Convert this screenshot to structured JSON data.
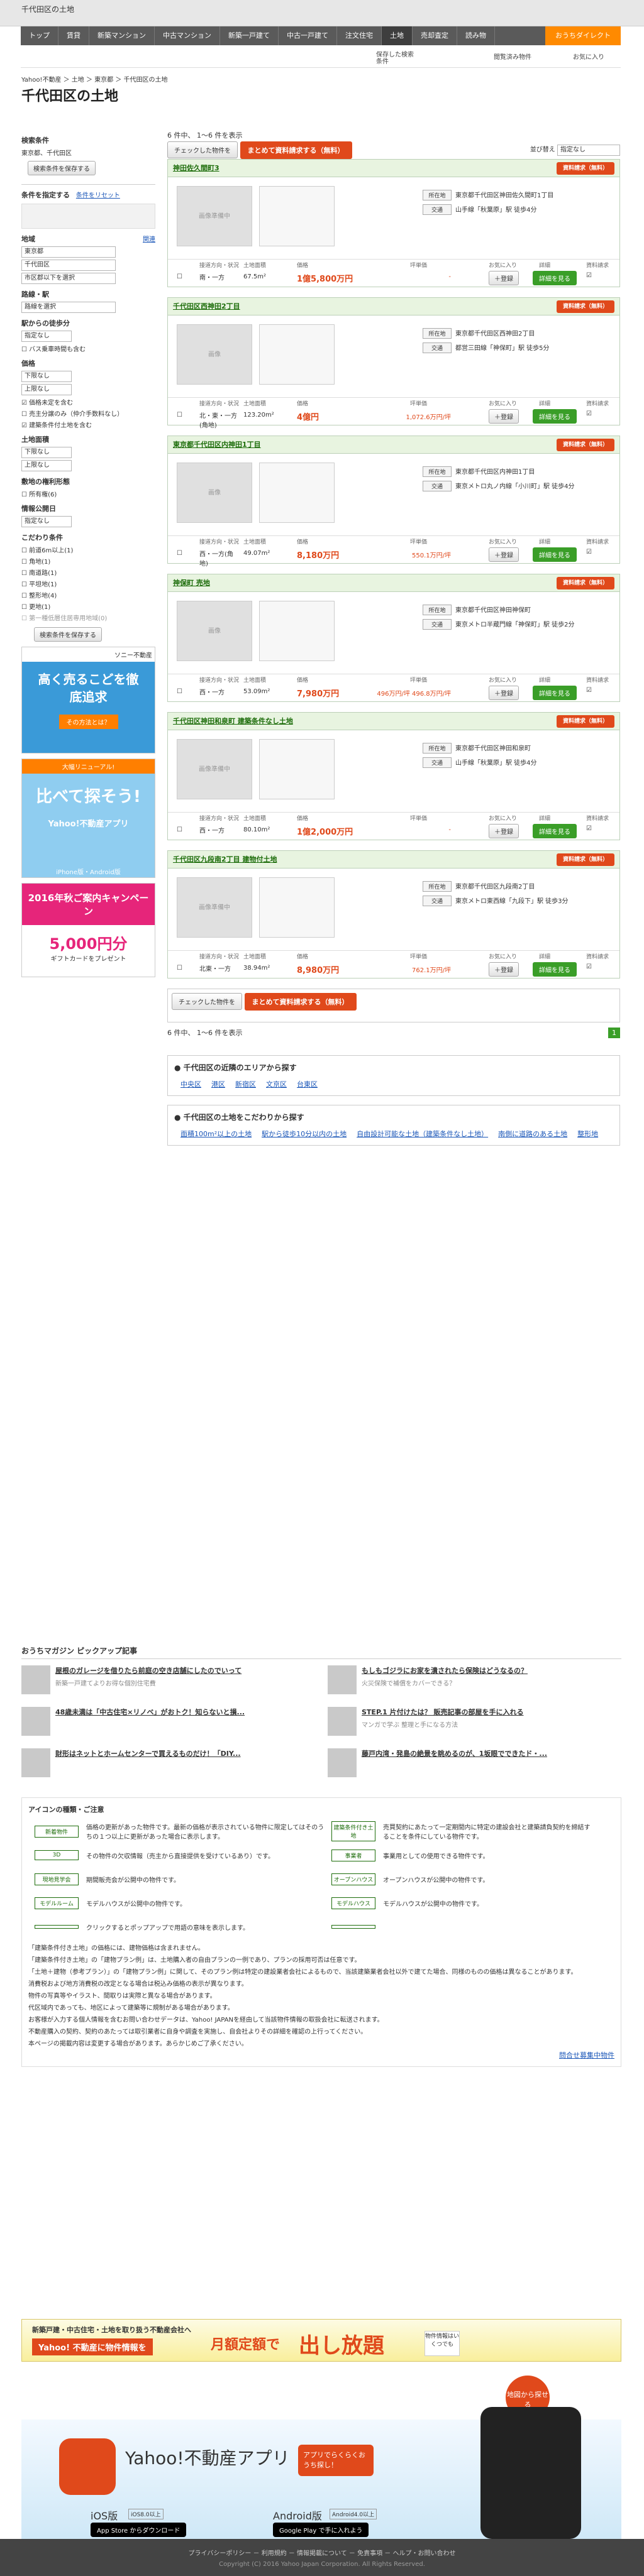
{
  "header": {
    "site": "Yahoo!不動産",
    "breadcrumb_top": "千代田区の土地"
  },
  "nav": {
    "items": [
      "トップ",
      "賃貸",
      "新築マンション",
      "中古マンション",
      "新築一戸建て",
      "中古一戸建て",
      "注文住宅",
      "土地",
      "売却査定",
      "読み物"
    ],
    "direct": "おうちダイレクト"
  },
  "subhead": {
    "saved": "保存した検索条件",
    "fav": "閲覧済み物件",
    "bookmark": "お気に入り"
  },
  "breadcrumb": "Yahoo!不動産 ＞ 土地 ＞ 東京都 ＞ 千代田区の土地",
  "title": "千代田区の土地",
  "sidebar": {
    "cond_title": "検索条件",
    "cond_value": "東京都、千代田区",
    "save_btn": "検索条件を保存する",
    "narrow": "条件を指定する",
    "reset": "条件をリセット",
    "region": "地域",
    "region_more": "関連",
    "region_sel": [
      "東京都",
      "千代田区",
      "市区郡以下を選択"
    ],
    "line": "路線・駅",
    "line_sel": "路線を選択",
    "walk": "駅からの徒歩分",
    "walk_sel": "指定なし",
    "walk_opt": "バス乗車時間も含む",
    "price": "価格",
    "price_min": "下限なし",
    "price_max": "上限なし",
    "price_opt1": "価格未定を含む",
    "price_opt2": "売主分譲のみ（仲介手数料なし）",
    "price_opt3": "建築条件付土地を含む",
    "area": "土地面積",
    "area_min": "下限なし",
    "area_max": "上限なし",
    "layout": "敷地の権利形態",
    "layout_opt": "所有権(6)",
    "date": "情報公開日",
    "date_sel": "指定なし",
    "kodawari": "こだわり条件",
    "kodawari_opts": [
      "前道6m以上(1)",
      "角地(1)",
      "南道路(1)",
      "平坦地(1)",
      "整形地(4)",
      "更地(1)",
      "第一種低層住居専用地域(0)"
    ],
    "search_btn": "検索条件を保存する"
  },
  "banners": {
    "b1_title": "高く売るこどを徹底追求",
    "b1_brand": "ソニー不動産",
    "b1_btn": "その方法とは？",
    "b2_top": "大幅リニューアル!",
    "b2_title": "比べて探そう!",
    "b2_app": "Yahoo!不動産アプリ",
    "b2_os": "iPhone版・Android版",
    "b3_title": "2016年秋ご案内キャンペーン",
    "b3_amount": "5,000円分",
    "b3_note": "ギフトカードをプレゼント"
  },
  "toolbar": {
    "count": "6 件中、 1〜6 件を表示",
    "chk": "チェックした物件を",
    "req": "まとめて資料請求する（無料）",
    "sort_label": "並び替え",
    "sort_val": "指定なし"
  },
  "cols": {
    "dir": "接道方向・状況",
    "area": "土地面積",
    "price": "価格",
    "unit": "坪単価",
    "fav": "お気に入り",
    "detail": "詳細",
    "req": "資料請求"
  },
  "listings": [
    {
      "name": "神田佐久間町3",
      "req": "資料請求（無料）",
      "addr": "東京都千代田区神田佐久間町1丁目",
      "tr": "山手線「秋葉原」駅 徒歩4分",
      "dir": "南・一方",
      "area": "67.5m²",
      "price": "1億5,800万円",
      "unit": "-",
      "photo": "画像準備中"
    },
    {
      "name": "千代田区西神田2丁目",
      "req": "資料請求（無料）",
      "addr": "東京都千代田区西神田2丁目",
      "tr": "都営三田線「神保町」駅 徒歩5分",
      "dir": "北・東・一方(角地)",
      "area": "123.20m²",
      "price": "4億円",
      "unit": "1,072.6万円/坪",
      "photo": "画像"
    },
    {
      "name": "東京都千代田区内神田1丁目",
      "req": "資料請求（無料）",
      "addr": "東京都千代田区内神田1丁目",
      "tr": "東京メトロ丸ノ内線「小川町」駅 徒歩4分",
      "dir": "西・一方(角地)",
      "area": "49.07m²",
      "price": "8,180万円",
      "unit": "550.1万円/坪",
      "photo": "画像"
    },
    {
      "name": "神保町 売地",
      "req": "資料請求（無料）",
      "addr": "東京都千代田区神田神保町",
      "tr": "東京メトロ半蔵門線「神保町」駅 徒歩2分",
      "dir": "西・一方",
      "area": "53.09m²",
      "price": "7,980万円",
      "unit": "496万円/坪 496.8万円/坪",
      "photo": "画像"
    },
    {
      "name": "千代田区神田和泉町 建築条件なし土地",
      "req": "資料請求（無料）",
      "addr": "東京都千代田区神田和泉町",
      "tr": "山手線「秋葉原」駅 徒歩4分",
      "dir": "西・一方",
      "area": "80.10m²",
      "price": "1億2,000万円",
      "unit": "-",
      "photo": "画像準備中"
    },
    {
      "name": "千代田区九段南2丁目 建物付土地",
      "req": "資料請求（無料）",
      "addr": "東京都千代田区九段南2丁目",
      "tr": "東京メトロ東西線「九段下」駅 徒歩3分",
      "dir": "北東・一方",
      "area": "38.94m²",
      "price": "8,980万円",
      "unit": "762.1万円/坪",
      "photo": "画像準備中"
    }
  ],
  "bottom": {
    "count": "6 件中、 1〜6 件を表示",
    "page": "1"
  },
  "nearby": {
    "title": "千代田区の近隣のエリアから探す",
    "items": [
      "中央区",
      "港区",
      "新宿区",
      "文京区",
      "台東区"
    ]
  },
  "kodawari_section": {
    "title": "千代田区の土地をこだわりから探す",
    "items": [
      "面積100m²以上の土地",
      "駅から徒歩10分以内の土地",
      "自由設計可能な土地（建築条件なし土地）",
      "南側に道路のある土地",
      "整形地"
    ]
  },
  "magazine": {
    "title": "おうちマガジン ピックアップ記事",
    "items": [
      {
        "t": "屋根のガレージを借りたら前庭の空き店舗にしたのでいって",
        "d": "新築一戸建てよりお得な個別住宅費"
      },
      {
        "t": "もしもゴジラにお家を潰されたら保険はどうなるの？",
        "d": "火災保険で補償をカバーできる？"
      },
      {
        "t": "48歳未満は「中古住宅×リノベ」がおトク！知らないと損...",
        "d": ""
      },
      {
        "t": "STEP.1 片付けたは？ 販売記事の部屋を手に入れる",
        "d": "マンガで学ぶ 整理と手になる方法"
      },
      {
        "t": "財形はネットとホームセンターで買えるものだけ！「DIY...",
        "d": ""
      },
      {
        "t": "藤戸内湾・発島の絶景を眺めるのが、1坂眼でできたド・...",
        "d": ""
      }
    ]
  },
  "legend": {
    "title": "アイコンの種類・ご注意",
    "rows": [
      [
        "新着物件",
        "価格の更新があった物件です。最新の価格が表示されている物件に限定してはそのうちの１つ以上に更新があった場合に表示します。",
        "建築条件付き土地",
        "売買契約にあたって一定期間内に特定の建設会社と建築請負契約を締結することを条件にしている物件です。"
      ],
      [
        "3D",
        "その物件の欠収情報（売主から直接提供を受けているあり）です。",
        "事業者",
        "事業用としての使用できる物件です。"
      ],
      [
        "現地見学会",
        "期間販売会が公開中の物件です。",
        "オープンハウス",
        "オープンハウスが公開中の物件です。"
      ],
      [
        "モデルルーム",
        "モデルハウスが公開中の物件です。",
        "モデルハウス",
        "モデルハウスが公開中の物件です。"
      ],
      [
        "",
        "クリックするとポップアップで用語の意味を表示します。",
        "",
        ""
      ]
    ],
    "notes": [
      "「建築条件付き土地」の価格には、建物価格は含まれません。",
      "「建築条件付き土地」の「建物プラン例」は、土地購入者の自由プランの一例であり、プランの採用可否は任意です。",
      "「土地＋建物（参考プラン）」の「建物プラン例」に関して、そのプラン例は特定の建設業者会社によるもので、当該建築業者会社以外で建てた場合、同様のものの価格は異なることがあります。",
      "消費税および地方消費税の改定となる場合は税込み価格の表示が異なります。",
      "物件の写真等やイラスト、間取りは実際と異なる場合があります。",
      "代区域内であっても、地区によって建築等に規制がある場合があります。",
      "お客様が入力する個人情報を含むお問い合わせデータは、Yahoo! JAPANを経由して当該物件情報の取扱会社に転送されます。",
      "不動産購入の契約、契約のあたっては取引業者に自身や調査を実施し、自会社よりその詳細を確認の上行ってください。",
      "本ページの掲載内容は変更する場合があります。あらかじめご了承ください。"
    ],
    "link": "問合せ募集中物件"
  },
  "ad1": {
    "l1": "新築戸建・中古住宅・土地を取り扱う不動産会社へ",
    "l2": "Yahoo! 不動産に物件情報を",
    "l3": "月額定額で",
    "l4": "出し放題",
    "l5": "物件情報はいくつでも"
  },
  "ad2": {
    "title": "Yahoo!不動産アプリ",
    "sub": "アプリでらくらくおうち探し！",
    "ios": "iOS版",
    "ios_ver": "iOS8.0以上",
    "android": "Android版",
    "android_ver": "Android4.0以上",
    "appstore": "App Store からダウンロード",
    "google": "Google Play で手に入れよう",
    "bubble": "地図から探せる"
  },
  "footer": {
    "links": "プライバシーポリシー － 利用規約 － 情報掲載について － 免責事項 － ヘルプ・お問い合わせ",
    "copy": "Copyright (C) 2016 Yahoo Japan Corporation. All Rights Reserved."
  }
}
